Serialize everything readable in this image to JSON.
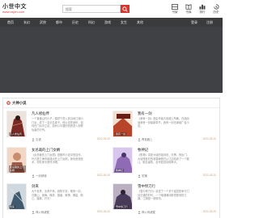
{
  "site": {
    "title": "小世中文",
    "url": "www.xsjzh.com"
  },
  "search": {
    "placeholder": "搜索"
  },
  "top_icons": [
    {
      "label": "书架",
      "icon": "bookshelf-icon"
    },
    {
      "label": "书库",
      "icon": "library-icon"
    },
    {
      "label": "排行",
      "icon": "ranking-icon"
    },
    {
      "label": "历史",
      "icon": "history-icon"
    }
  ],
  "nav": {
    "items": [
      "首页",
      "玄幻",
      "武侠",
      "都市",
      "历史",
      "科幻",
      "游戏",
      "女生",
      "其他"
    ],
    "right": [
      "登录",
      "注册"
    ]
  },
  "panel": {
    "title": "大神小说",
    "books": [
      {
        "title": "凡人修仙传",
        "desc": "一个普通山村小子，偶然下进入到当地江湖小门派，成了一名记名弟子。他以这样身份，如何在门派中立足，如何以平庸的资质进入到修仙者的行列。",
        "author": "忘语",
        "date": "2022-05-20",
        "cover_text": "凡人修仙传",
        "cover_color": "#7a2a22"
      },
      {
        "title": "我有一剑",
        "desc": "《我有一剑》是由作者青鸾峰上所著，在线阅读我有一剑最新章节，我有一剑无弹窗广告小说。",
        "author": "青鸾峰上",
        "date": "2022-05-20",
        "cover_text": "我有一剑",
        "cover_color": "#b8442a"
      },
      {
        "title": "女总裁的上门女婿",
        "desc": "《女总裁的上门女婿》是都市小说中的佳作，叶凡是江海市最强大的上门女婿，身负绝世医术，却在家中受尽冷眼。",
        "author": "一剑倾城",
        "date": "2022-05-20",
        "cover_text": "女总裁的上门女婿",
        "cover_color": "#c98c6e"
      },
      {
        "title": "牧神记",
        "desc": "《牧神》讲述大墟的祖训说，天黑，别出门。大墟残老村的老弱病残们从江边捡到了一个婴儿，取名秦牧，含辛茹苦将他养大。",
        "author": "宅猪",
        "date": "2022-05-20",
        "cover_text": "牧神记",
        "cover_color": "#8f6bb5"
      },
      {
        "title": "剑来",
        "desc": "大千世界，无奇不有。我陈平安，唯有一剑，可搬山、倒海、降妖、镇魔、敕神、摘星、断江、摧城、开天！",
        "author": "烽火戏诸侯",
        "date": "2022-05-20",
        "cover_text": "剑来",
        "cover_color": "#3f5a6e"
      },
      {
        "title": "雪中悍刀行",
        "desc": "《雪中悍刀行》讲述了一个关于庙堂权争与刀剑交错的时代，一个暗潮涌动粉墨登场的江湖。江湖是一张珠帘。",
        "author": "烽火戏诸侯",
        "date": "2022-05-20",
        "cover_text": "雪中悍刀行",
        "cover_color": "#4a3a5a"
      }
    ]
  }
}
